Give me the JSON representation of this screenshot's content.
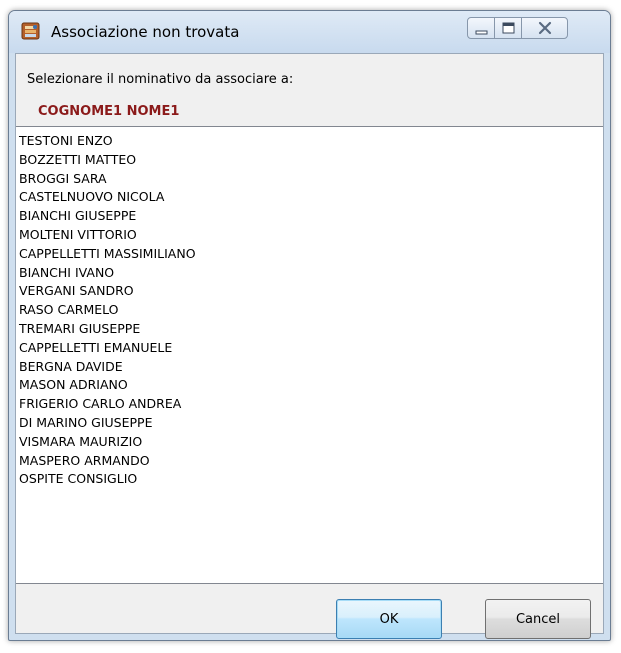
{
  "window": {
    "title": "Associazione non trovata",
    "icon": "app-database-icon"
  },
  "controls": {
    "minimize_icon": "minimize-icon",
    "maximize_icon": "maximize-icon",
    "close_icon": "close-icon"
  },
  "dialog": {
    "prompt": "Selezionare il nominativo da associare a:",
    "target_name": "COGNOME1 NOME1",
    "target_color": "#8b1a1a"
  },
  "list": {
    "items": [
      "TESTONI ENZO",
      "BOZZETTI MATTEO",
      "BROGGI SARA",
      "CASTELNUOVO NICOLA",
      "BIANCHI GIUSEPPE",
      "MOLTENI VITTORIO",
      "CAPPELLETTI MASSIMILIANO",
      "BIANCHI IVANO",
      "VERGANI SANDRO",
      "RASO CARMELO",
      "TREMARI GIUSEPPE",
      "CAPPELLETTI EMANUELE",
      "BERGNA DAVIDE",
      "MASON ADRIANO",
      "FRIGERIO CARLO ANDREA",
      "DI MARINO GIUSEPPE",
      "VISMARA MAURIZIO",
      "MASPERO ARMANDO",
      "OSPITE CONSIGLIO"
    ]
  },
  "buttons": {
    "ok_label": "OK",
    "cancel_label": "Cancel"
  }
}
